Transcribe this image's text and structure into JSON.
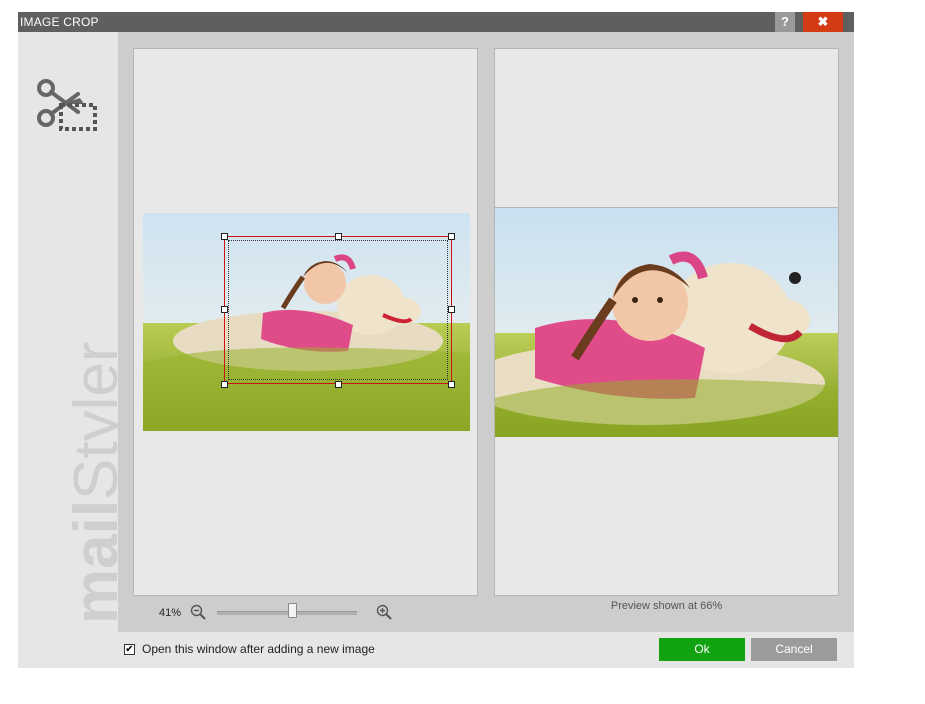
{
  "window": {
    "title": "IMAGE CROP",
    "help_label": "?",
    "close_label": "✖"
  },
  "sidebar": {
    "icon": "scissors-crop-icon",
    "brand_bold": "mail",
    "brand_light": "Styler"
  },
  "editor": {
    "zoom_label": "41%",
    "zoom_level": 0.55
  },
  "preview": {
    "label": "Preview shown at 66%"
  },
  "footer": {
    "checkbox_checked": true,
    "checkbox_label": "Open this window after adding a new image",
    "ok_label": "Ok",
    "cancel_label": "Cancel"
  },
  "colors": {
    "title_bar": "#5f5f5f",
    "close": "#d23b14",
    "ok": "#12a312",
    "cancel": "#9b9b9b",
    "crop_border": "#cc1111"
  }
}
